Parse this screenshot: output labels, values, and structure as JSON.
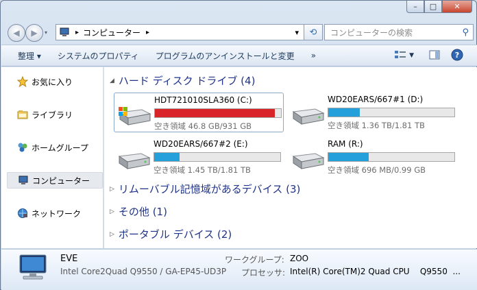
{
  "window": {
    "minimize_glyph": "–",
    "maximize_glyph": "□",
    "close_glyph": "✕"
  },
  "address": {
    "crumb": "コンピューター",
    "arrow": "▸",
    "dropdown": "▾"
  },
  "search": {
    "placeholder": "コンピューターの検索"
  },
  "toolbar": {
    "organize": "整理 ▾",
    "system_properties": "システムのプロパティ",
    "uninstall": "プログラムのアンインストールと変更",
    "more": "»"
  },
  "sidebar": {
    "items": [
      {
        "label": "お気に入り",
        "icon": "star-icon"
      },
      {
        "label": "ライブラリ",
        "icon": "library-icon"
      },
      {
        "label": "ホームグループ",
        "icon": "homegroup-icon"
      },
      {
        "label": "コンピューター",
        "icon": "computer-icon",
        "selected": true
      },
      {
        "label": "ネットワーク",
        "icon": "network-icon"
      }
    ]
  },
  "groups": {
    "hdd": "ハード ディスク ドライブ (4)",
    "removable": "リムーバブル記憶域があるデバイス (3)",
    "other": "その他 (1)",
    "portable": "ポータブル デバイス (2)"
  },
  "drives": [
    {
      "name": "HDT721010SLA360 (C:)",
      "free": "空き領域 46.8 GB/931 GB",
      "used_fraction": 0.95,
      "bar_color": "#d9252a",
      "icon": "windows-drive-icon"
    },
    {
      "name": "WD20EARS/667#1 (D:)",
      "free": "空き領域 1.36 TB/1.81 TB",
      "used_fraction": 0.25,
      "bar_color": "#26a0da",
      "icon": "drive-icon"
    },
    {
      "name": "WD20EARS/667#2 (E:)",
      "free": "空き領域 1.45 TB/1.81 TB",
      "used_fraction": 0.2,
      "bar_color": "#26a0da",
      "icon": "drive-icon"
    },
    {
      "name": "RAM (R:)",
      "free": "空き領域 696 MB/0.99 GB",
      "used_fraction": 0.32,
      "bar_color": "#26a0da",
      "icon": "drive-icon"
    }
  ],
  "status": {
    "name": "EVE",
    "desc": "Intel Core2Quad Q9550 / GA-EP45-UD3P",
    "workgroup_label": "ワークグループ:",
    "workgroup_value": "ZOO",
    "processor_label": "プロセッサ:",
    "processor_value": "Intel(R) Core(TM)2 Quad CPU    Q9550  ..."
  }
}
